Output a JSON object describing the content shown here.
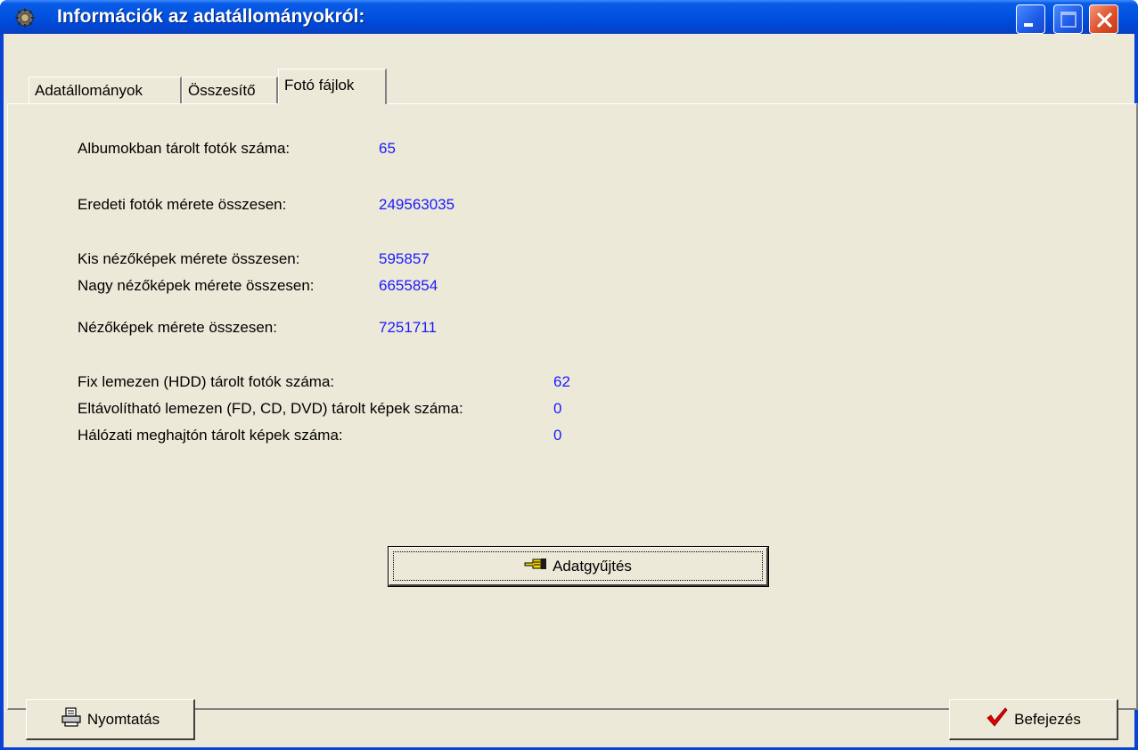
{
  "window": {
    "title": "Információk az adatállományokról:",
    "accent_color": "#0a5ce6",
    "client_color": "#ece9d8"
  },
  "titlebar_buttons": {
    "minimize_icon": "minimize-icon",
    "maximize_icon": "maximize-icon",
    "close_icon": "close-icon"
  },
  "tabs": [
    {
      "label": "Adatállományok",
      "active": false
    },
    {
      "label": "Összesítő",
      "active": false
    },
    {
      "label": "Fotó fájlok",
      "active": true
    }
  ],
  "stats": {
    "album_photos": {
      "label": "Albumokban tárolt fotók száma:",
      "value": "65"
    },
    "original_size": {
      "label": "Eredeti fotók mérete összesen:",
      "value": "249563035"
    },
    "small_thumbs": {
      "label": "Kis nézőképek mérete összesen:",
      "value": "595857"
    },
    "large_thumbs": {
      "label": "Nagy nézőképek mérete összesen:",
      "value": "6655854"
    },
    "thumbs_total": {
      "label": "Nézőképek mérete összesen:",
      "value": "7251711"
    },
    "hdd_photos": {
      "label": "Fix lemezen (HDD) tárolt fotók száma:",
      "value": "62"
    },
    "removable_images": {
      "label": "Eltávolítható  lemezen (FD, CD, DVD) tárolt képek száma:",
      "value": "0"
    },
    "network_images": {
      "label": "Hálózati meghajtón tárolt képek száma:",
      "value": "0"
    },
    "value_color": "#1a1aff"
  },
  "buttons": {
    "collect": {
      "label": "Adatgyűjtés",
      "icon": "pointing-hand-icon"
    },
    "print": {
      "label": "Nyomtatás",
      "icon": "printer-icon"
    },
    "finish": {
      "label": "Befejezés",
      "icon": "checkmark-icon",
      "icon_color": "#e00000"
    }
  }
}
